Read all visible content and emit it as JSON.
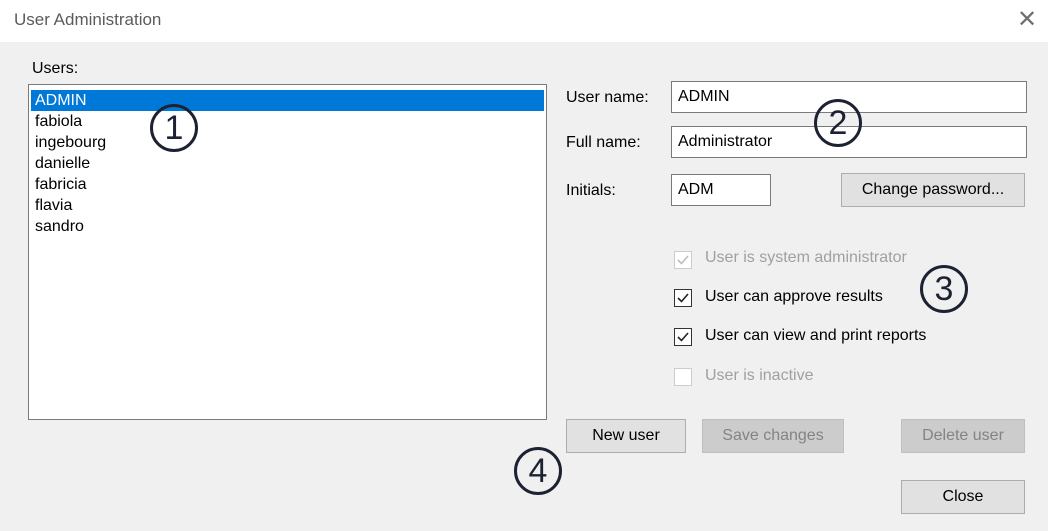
{
  "window": {
    "title": "User Administration",
    "close_icon": "close-icon"
  },
  "users_label": "Users:",
  "users": [
    "ADMIN",
    "fabiola",
    "ingebourg",
    "danielle",
    "fabricia",
    "flavia",
    "sandro"
  ],
  "selected_user": "ADMIN",
  "fields": {
    "user_name_label": "User name:",
    "user_name_value": "ADMIN",
    "full_name_label": "Full name:",
    "full_name_value": "Administrator",
    "initials_label": "Initials:",
    "initials_value": "ADM"
  },
  "buttons": {
    "change_password": "Change password...",
    "new_user": "New user",
    "save_changes": "Save changes",
    "delete_user": "Delete user",
    "close": "Close"
  },
  "checkboxes": [
    {
      "label": "User is system administrator",
      "checked": true,
      "enabled": false
    },
    {
      "label": "User can approve results",
      "checked": true,
      "enabled": true
    },
    {
      "label": "User can view and print reports",
      "checked": true,
      "enabled": true
    },
    {
      "label": "User is inactive",
      "checked": false,
      "enabled": false
    }
  ],
  "markers": [
    "1",
    "2",
    "3",
    "4"
  ],
  "colors": {
    "selection": "#0078d7",
    "dialog_bg": "#f0f0f0",
    "marker": "#1d2233"
  }
}
